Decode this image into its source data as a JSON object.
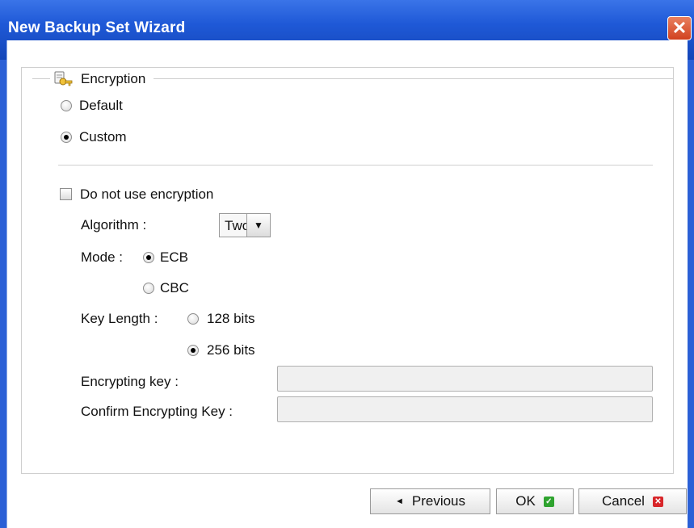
{
  "window": {
    "title": "New Backup Set Wizard",
    "close_glyph": "✕"
  },
  "encryption": {
    "legend": "Encryption",
    "legend_icon": "key-icon",
    "options": [
      {
        "label": "Default",
        "checked": false
      },
      {
        "label": "Custom",
        "checked": true
      }
    ],
    "no_encryption_label": "Do not use encryption",
    "no_encryption_checked": false,
    "algorithm_label": "Algorithm :",
    "algorithm_value": "Twofish",
    "mode_label": "Mode :",
    "modes": [
      {
        "label": "ECB",
        "checked": true
      },
      {
        "label": "CBC",
        "checked": false
      }
    ],
    "key_length_label": "Key Length :",
    "key_lengths": [
      {
        "label": "128 bits",
        "checked": false
      },
      {
        "label": "256 bits",
        "checked": true
      }
    ],
    "encrypting_key_label": "Encrypting key :",
    "encrypting_key_value": "",
    "confirm_key_label": "Confirm Encrypting Key :",
    "confirm_key_value": ""
  },
  "footer": {
    "previous_label": "Previous",
    "previous_icon": "arrow-left-icon",
    "ok_label": "OK",
    "ok_icon": "check-icon",
    "cancel_label": "Cancel",
    "cancel_icon": "close-icon"
  },
  "colors": {
    "titlebar": "#1f59d7",
    "ok_green": "#2fa32f",
    "cancel_red": "#d8262a"
  }
}
